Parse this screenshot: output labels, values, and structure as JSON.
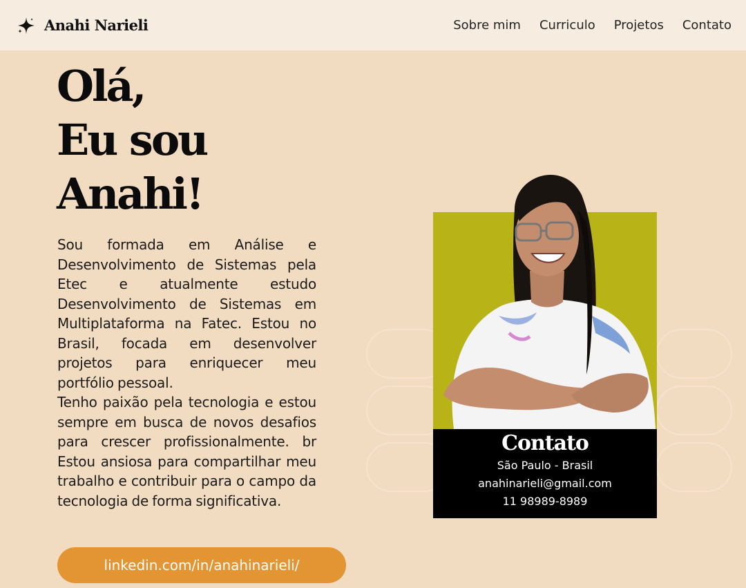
{
  "nav": {
    "brand": "Anahi Narieli",
    "brand_icon": "sparkle-icon",
    "links": [
      "Sobre mim",
      "Curriculo",
      "Projetos",
      "Contato"
    ]
  },
  "hero": {
    "line1": "Olá,",
    "line2": "Eu sou",
    "line3": "Anahi!"
  },
  "bio": {
    "p1": "Sou formada em Análise e Desenvolvimento de Sistemas pela Etec e atualmente estudo Desenvolvimento de Sistemas em Multiplataforma na Fatec. Estou no Brasil, focada em desenvolver projetos para enriquecer meu portfólio pessoal.",
    "p2": "Tenho paixão pela tecnologia e estou sempre em busca de novos desafios para crescer profissionalmente. br Estou ansiosa para compartilhar meu trabalho e contribuir para o campo da tecnologia de forma significativa."
  },
  "linkedin": "linkedin.com/in/anahinarieli/",
  "contact": {
    "title": "Contato",
    "location": "São Paulo - Brasil",
    "email": "anahinarieli@gmail.com",
    "phone": "11 98989-8989"
  },
  "colors": {
    "background": "#f2dcc1",
    "navbar": "#f6ece0",
    "accent": "#e39433",
    "photo_bg": "#b8b317",
    "card": "#000000"
  }
}
